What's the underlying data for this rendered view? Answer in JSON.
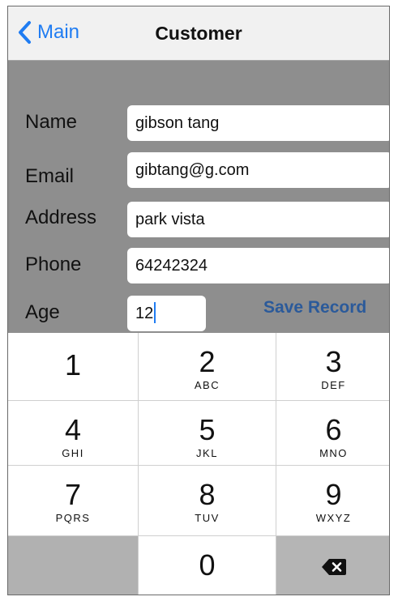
{
  "navbar": {
    "back_label": "Main",
    "title": "Customer"
  },
  "form": {
    "fields": [
      {
        "label": "Name",
        "value": "gibson tang"
      },
      {
        "label": "Email",
        "value": "gibtang@g.com"
      },
      {
        "label": "Address",
        "value": "park vista"
      },
      {
        "label": "Phone",
        "value": "64242324"
      },
      {
        "label": "Age",
        "value": "12"
      }
    ],
    "save_label": "Save Record"
  },
  "keypad": {
    "keys": [
      {
        "num": "1",
        "letters": ""
      },
      {
        "num": "2",
        "letters": "ABC"
      },
      {
        "num": "3",
        "letters": "DEF"
      },
      {
        "num": "4",
        "letters": "GHI"
      },
      {
        "num": "5",
        "letters": "JKL"
      },
      {
        "num": "6",
        "letters": "MNO"
      },
      {
        "num": "7",
        "letters": "PQRS"
      },
      {
        "num": "8",
        "letters": "TUV"
      },
      {
        "num": "9",
        "letters": "WXYZ"
      },
      {
        "num": "0",
        "letters": ""
      }
    ],
    "delete_icon": "backspace-icon"
  },
  "colors": {
    "accent": "#1f7cf2",
    "save_link": "#2b5a9a",
    "form_background": "#8e8e8e",
    "keypad_grey": "#b1b1b1"
  }
}
